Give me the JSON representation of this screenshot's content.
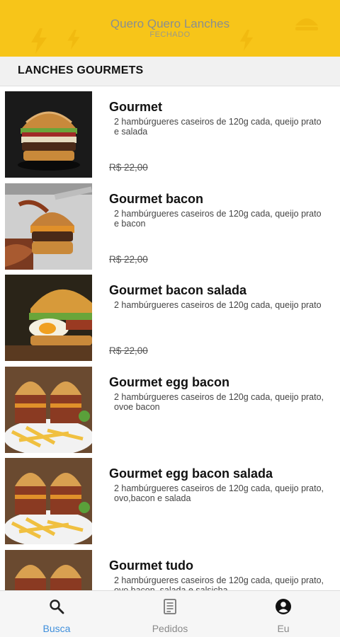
{
  "header": {
    "title": "Quero Quero Lanches",
    "status": "FECHADO",
    "background_color": "#f7c519"
  },
  "section": {
    "title": "LANCHES GOURMETS"
  },
  "items": [
    {
      "name": "Gourmet",
      "description": "2 hambúrgueres caseiros de 120g cada, queijo prato e salada",
      "price": "R$ 22,00",
      "image": "burger-photo"
    },
    {
      "name": "Gourmet bacon",
      "description": "2 hambúrgueres caseiros de 120g cada, queijo prato e bacon",
      "price": "R$ 22,00",
      "image": "bacon-burger-photo"
    },
    {
      "name": "Gourmet bacon salada",
      "description": "2 hambúrgueres caseiros de 120g cada, queijo prato",
      "price": "R$ 22,00",
      "image": "egg-burger-photo"
    },
    {
      "name": "Gourmet egg bacon",
      "description": "2 hambúrgueres caseiros de 120g cada, queijo prato, ovoe bacon",
      "price": "",
      "image": "burger-fries-photo"
    },
    {
      "name": "Gourmet egg bacon salada",
      "description": "2 hambúrgueres caseiros de 120g cada, queijo prato, ovo,bacon e salada",
      "price": "",
      "image": "burger-fries-photo"
    },
    {
      "name": "Gourmet tudo",
      "description": "2 hambúrgueres caseiros de 120g cada, queijo prato, ovo,bacon, salada e salsicha",
      "price": "",
      "image": "burger-fries-photo"
    }
  ],
  "bottom_nav": [
    {
      "label": "Busca",
      "icon": "search-icon",
      "active": true
    },
    {
      "label": "Pedidos",
      "icon": "document-icon",
      "active": false
    },
    {
      "label": "Eu",
      "icon": "account-icon",
      "active": false
    }
  ],
  "colors": {
    "accent": "#3f8fdc",
    "header": "#f7c519"
  }
}
